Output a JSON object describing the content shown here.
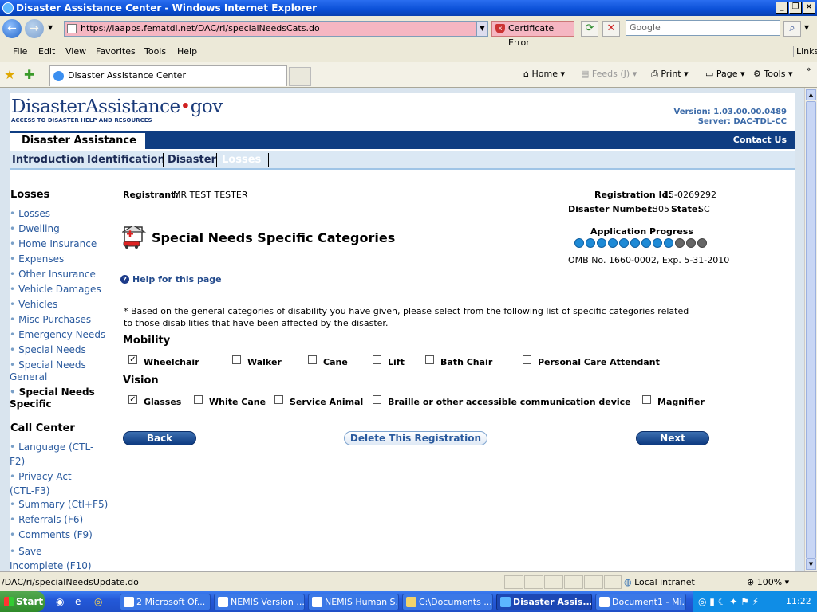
{
  "window": {
    "title": "Disaster Assistance Center - Windows Internet Explorer"
  },
  "address": {
    "url": "https://iaapps.fematdl.net/DAC/ri/specialNeedsCats.do",
    "cert_error": "Certificate Error",
    "search_placeholder": "Google"
  },
  "menu": [
    "File",
    "Edit",
    "View",
    "Favorites",
    "Tools",
    "Help"
  ],
  "links_label": "Links",
  "tab": {
    "title": "Disaster Assistance Center"
  },
  "commands": {
    "home": "Home",
    "feeds": "Feeds (J)",
    "print": "Print",
    "page": "Page",
    "tools": "Tools"
  },
  "site": {
    "logo_main": "DisasterAssistance",
    "logo_gov": "gov",
    "logo_tag": "ACCESS TO DISASTER HELP AND RESOURCES",
    "version": "Version: 1.03.00.00.0489",
    "server": "Server: DAC-TDL-CC",
    "section_tab": "Disaster Assistance",
    "contact": "Contact Us",
    "nav": [
      "Introduction",
      "Identification",
      "Disaster",
      "Losses"
    ]
  },
  "sidebar": {
    "losses_title": "Losses",
    "losses_items": [
      "Losses",
      "Dwelling",
      "Home Insurance",
      "Expenses",
      "Other Insurance",
      "Vehicle Damages",
      "Vehicles",
      "Misc Purchases",
      "Emergency Needs",
      "Special Needs",
      "Special Needs General",
      "Special Needs Specific"
    ],
    "call_title": "Call Center",
    "call_items": [
      "Language (CTL-F2)",
      "Privacy Act (CTL-F3)",
      "Summary (Ctl+F5)",
      "Referrals (F6)",
      "Comments (F9)",
      "Save Incomplete (F10)"
    ]
  },
  "registrant": {
    "label": "Registrant:",
    "value": "MR TEST TESTER"
  },
  "registration": {
    "id_label": "Registration Id:",
    "id_value": "15-0269292",
    "disaster_label": "Disaster Number:",
    "disaster_value": "1305",
    "state_label": "State:",
    "state_value": "SC"
  },
  "page_title": "Special Needs Specific Categories",
  "progress": {
    "label": "Application Progress",
    "total": 12,
    "completed": 9
  },
  "omb": "OMB No. 1660-0002, Exp. 5-31-2010",
  "help": "Help for this page",
  "instructions": "* Based on the general categories of disability you have given, please select from the following list of specific categories related to those disabilities that have been affected by the disaster.",
  "mobility": {
    "title": "Mobility",
    "options": [
      {
        "label": "Wheelchair",
        "checked": true
      },
      {
        "label": "Walker",
        "checked": false
      },
      {
        "label": "Cane",
        "checked": false
      },
      {
        "label": "Lift",
        "checked": false
      },
      {
        "label": "Bath Chair",
        "checked": false
      },
      {
        "label": "Personal Care Attendant",
        "checked": false
      }
    ]
  },
  "vision": {
    "title": "Vision",
    "options": [
      {
        "label": "Glasses",
        "checked": true
      },
      {
        "label": "White Cane",
        "checked": false
      },
      {
        "label": "Service Animal",
        "checked": false
      },
      {
        "label": "Braille or other accessible communication device",
        "checked": false
      },
      {
        "label": "Magnifier",
        "checked": false
      }
    ]
  },
  "buttons": {
    "back": "Back",
    "delete": "Delete This Registration",
    "next": "Next"
  },
  "status": {
    "url": "/DAC/ri/specialNeedsUpdate.do",
    "zone": "Local intranet",
    "zoom": "100%"
  },
  "taskbar": {
    "start": "Start",
    "items": [
      "2 Microsoft Of...",
      "NEMIS Version ...",
      "NEMIS Human S...",
      "C:\\Documents ...",
      "Disaster Assis...",
      "Document1 - Mi..."
    ],
    "clock": "11:22"
  },
  "colors": {
    "brand_blue": "#0f3d82",
    "link": "#2a5a9e",
    "progress_done": "#1e8ad6",
    "progress_todo": "#666666"
  }
}
